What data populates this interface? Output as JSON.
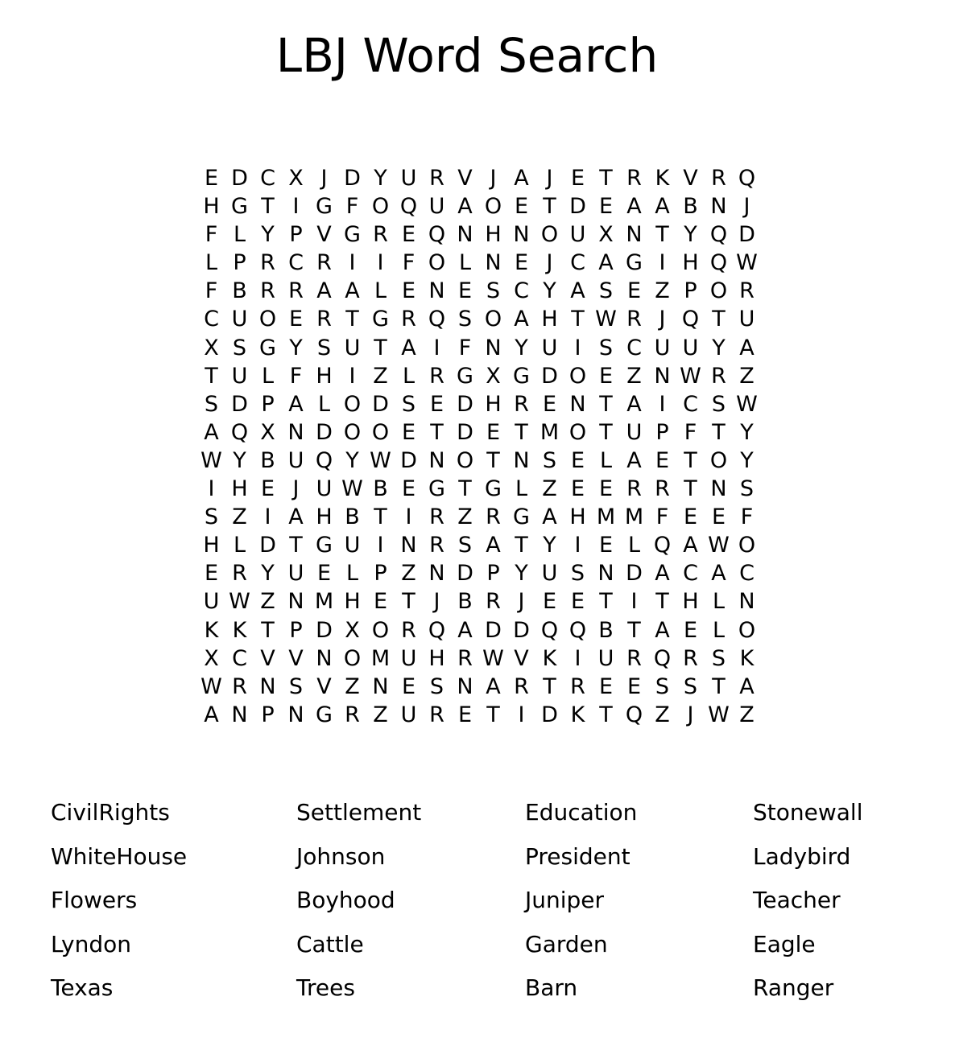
{
  "title": "LBJ Word Search",
  "grid": [
    [
      "E",
      "D",
      "C",
      "X",
      "J",
      "D",
      "Y",
      "U",
      "R",
      "V",
      "J",
      "A",
      "J",
      "E",
      "T",
      "R",
      "K",
      "V",
      "R",
      "Q"
    ],
    [
      "H",
      "G",
      "T",
      "I",
      "G",
      "F",
      "O",
      "Q",
      "U",
      "A",
      "O",
      "E",
      "T",
      "D",
      "E",
      "A",
      "A",
      "B",
      "N",
      "J"
    ],
    [
      "F",
      "L",
      "Y",
      "P",
      "V",
      "G",
      "R",
      "E",
      "Q",
      "N",
      "H",
      "N",
      "O",
      "U",
      "X",
      "N",
      "T",
      "Y",
      "Q",
      "D"
    ],
    [
      "L",
      "P",
      "R",
      "C",
      "R",
      "I",
      "I",
      "F",
      "O",
      "L",
      "N",
      "E",
      "J",
      "C",
      "A",
      "G",
      "I",
      "H",
      "Q",
      "W"
    ],
    [
      "F",
      "B",
      "R",
      "R",
      "A",
      "A",
      "L",
      "E",
      "N",
      "E",
      "S",
      "C",
      "Y",
      "A",
      "S",
      "E",
      "Z",
      "P",
      "O",
      "R"
    ],
    [
      "C",
      "U",
      "O",
      "E",
      "R",
      "T",
      "G",
      "R",
      "Q",
      "S",
      "O",
      "A",
      "H",
      "T",
      "W",
      "R",
      "J",
      "Q",
      "T",
      "U"
    ],
    [
      "X",
      "S",
      "G",
      "Y",
      "S",
      "U",
      "T",
      "A",
      "I",
      "F",
      "N",
      "Y",
      "U",
      "I",
      "S",
      "C",
      "U",
      "U",
      "Y",
      "A"
    ],
    [
      "T",
      "U",
      "L",
      "F",
      "H",
      "I",
      "Z",
      "L",
      "R",
      "G",
      "X",
      "G",
      "D",
      "O",
      "E",
      "Z",
      "N",
      "W",
      "R",
      "Z"
    ],
    [
      "S",
      "D",
      "P",
      "A",
      "L",
      "O",
      "D",
      "S",
      "E",
      "D",
      "H",
      "R",
      "E",
      "N",
      "T",
      "A",
      "I",
      "C",
      "S",
      "W"
    ],
    [
      "A",
      "Q",
      "X",
      "N",
      "D",
      "O",
      "O",
      "E",
      "T",
      "D",
      "E",
      "T",
      "M",
      "O",
      "T",
      "U",
      "P",
      "F",
      "T",
      "Y"
    ],
    [
      "W",
      "Y",
      "B",
      "U",
      "Q",
      "Y",
      "W",
      "D",
      "N",
      "O",
      "T",
      "N",
      "S",
      "E",
      "L",
      "A",
      "E",
      "T",
      "O",
      "Y"
    ],
    [
      "I",
      "H",
      "E",
      "J",
      "U",
      "W",
      "B",
      "E",
      "G",
      "T",
      "G",
      "L",
      "Z",
      "E",
      "E",
      "R",
      "R",
      "T",
      "N",
      "S"
    ],
    [
      "S",
      "Z",
      "I",
      "A",
      "H",
      "B",
      "T",
      "I",
      "R",
      "Z",
      "R",
      "G",
      "A",
      "H",
      "M",
      "M",
      "F",
      "E",
      "E",
      "F"
    ],
    [
      "H",
      "L",
      "D",
      "T",
      "G",
      "U",
      "I",
      "N",
      "R",
      "S",
      "A",
      "T",
      "Y",
      "I",
      "E",
      "L",
      "Q",
      "A",
      "W",
      "O"
    ],
    [
      "E",
      "R",
      "Y",
      "U",
      "E",
      "L",
      "P",
      "Z",
      "N",
      "D",
      "P",
      "Y",
      "U",
      "S",
      "N",
      "D",
      "A",
      "C",
      "A",
      "C"
    ],
    [
      "U",
      "W",
      "Z",
      "N",
      "M",
      "H",
      "E",
      "T",
      "J",
      "B",
      "R",
      "J",
      "E",
      "E",
      "T",
      "I",
      "T",
      "H",
      "L",
      "N"
    ],
    [
      "K",
      "K",
      "T",
      "P",
      "D",
      "X",
      "O",
      "R",
      "Q",
      "A",
      "D",
      "D",
      "Q",
      "Q",
      "B",
      "T",
      "A",
      "E",
      "L",
      "O"
    ],
    [
      "X",
      "C",
      "V",
      "V",
      "N",
      "O",
      "M",
      "U",
      "H",
      "R",
      "W",
      "V",
      "K",
      "I",
      "U",
      "R",
      "Q",
      "R",
      "S",
      "K"
    ],
    [
      "W",
      "R",
      "N",
      "S",
      "V",
      "Z",
      "N",
      "E",
      "S",
      "N",
      "A",
      "R",
      "T",
      "R",
      "E",
      "E",
      "S",
      "S",
      "T",
      "A"
    ],
    [
      "A",
      "N",
      "P",
      "N",
      "G",
      "R",
      "Z",
      "U",
      "R",
      "E",
      "T",
      "I",
      "D",
      "K",
      "T",
      "Q",
      "Z",
      "J",
      "W",
      "Z"
    ]
  ],
  "word_columns": [
    [
      "CivilRights",
      "WhiteHouse",
      "Flowers",
      "Lyndon",
      "Texas"
    ],
    [
      "Settlement",
      "Johnson",
      "Boyhood",
      "Cattle",
      "Trees"
    ],
    [
      "Education",
      "President",
      "Juniper",
      "Garden",
      "Barn"
    ],
    [
      "Stonewall",
      "Ladybird",
      "Teacher",
      "Eagle",
      "Ranger"
    ]
  ]
}
